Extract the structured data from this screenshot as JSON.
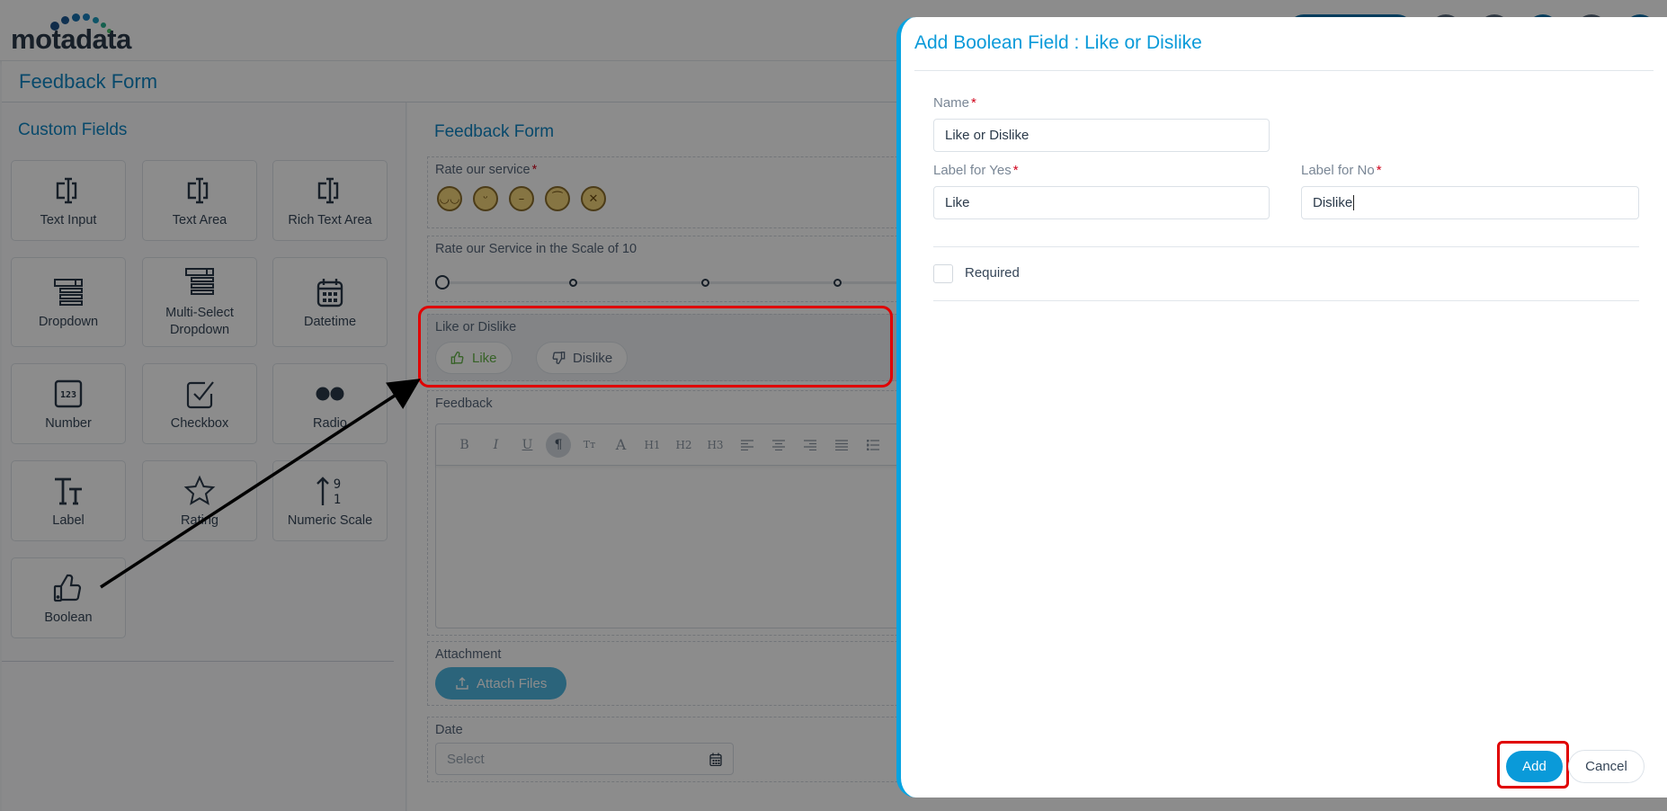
{
  "brand": {
    "logo_text": "motadata"
  },
  "page": {
    "title": "Feedback Form"
  },
  "left_panel": {
    "title": "Custom Fields",
    "tiles": [
      {
        "label": "Text Input",
        "icon": "text-input-icon"
      },
      {
        "label": "Text Area",
        "icon": "text-area-icon"
      },
      {
        "label": "Rich Text Area",
        "icon": "rich-text-area-icon"
      },
      {
        "label": "Dropdown",
        "icon": "dropdown-icon"
      },
      {
        "label": "Multi-Select Dropdown",
        "icon": "multi-select-dropdown-icon"
      },
      {
        "label": "Datetime",
        "icon": "calendar-icon"
      },
      {
        "label": "Number",
        "icon": "number-123-icon"
      },
      {
        "label": "Checkbox",
        "icon": "checkbox-icon"
      },
      {
        "label": "Radio",
        "icon": "radio-icon"
      },
      {
        "label": "Label",
        "icon": "label-tt-icon"
      },
      {
        "label": "Rating",
        "icon": "star-icon"
      },
      {
        "label": "Numeric Scale",
        "icon": "numeric-scale-icon"
      },
      {
        "label": "Boolean",
        "icon": "thumbs-up-icon"
      }
    ]
  },
  "form": {
    "title": "Feedback Form",
    "fields": {
      "rate_service": {
        "label": "Rate our service",
        "required": "*",
        "emojis": [
          "grinning",
          "smiling",
          "neutral",
          "confused",
          "tired"
        ]
      },
      "scale": {
        "label": "Rate our Service in the Scale of 10"
      },
      "like_dislike": {
        "label": "Like or Dislike",
        "yes_label": "Like",
        "no_label": "Dislike"
      },
      "feedback": {
        "label": "Feedback",
        "toolbar": [
          "B",
          "I",
          "U",
          "¶",
          "Tт",
          "A",
          "H1",
          "H2",
          "H3",
          "align-left",
          "align-center",
          "align-right",
          "justify",
          "bullet-list"
        ]
      },
      "attachment": {
        "label": "Attachment",
        "button": "Attach Files"
      },
      "date": {
        "label": "Date",
        "placeholder": "Select"
      }
    }
  },
  "modal": {
    "title": "Add Boolean Field : Like or Dislike",
    "name_label": "Name",
    "name_value": "Like or Dislike",
    "yes_label": "Label for Yes",
    "yes_value": "Like",
    "no_label": "Label for No",
    "no_value": "Dislike",
    "required_star": "*",
    "required_label": "Required",
    "required_checked": false,
    "add_button": "Add",
    "cancel_button": "Cancel"
  },
  "colors": {
    "accent": "#0a9ad9",
    "title_blue": "#0f86c4",
    "annotation_red": "#e00000",
    "like_green": "#63b246"
  }
}
